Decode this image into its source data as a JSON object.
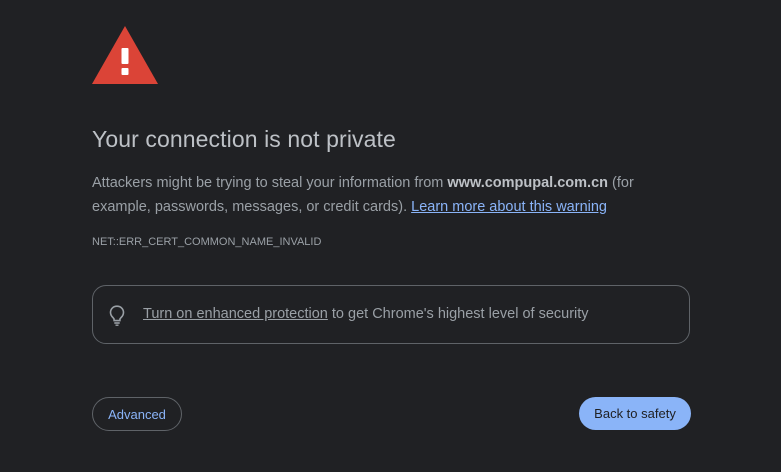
{
  "icons": {
    "warning": "warning-triangle-icon",
    "bulb": "lightbulb-icon"
  },
  "colors": {
    "background": "#202124",
    "warning_red": "#db4437",
    "link_blue": "#8ab4f8",
    "text_primary": "#bdc1c6",
    "text_secondary": "#9aa0a6"
  },
  "heading": "Your connection is not private",
  "description": {
    "prefix": "Attackers might be trying to steal your information from ",
    "domain": "www.compupal.com.cn",
    "suffix": " (for example, passwords, messages, or credit cards). ",
    "learn_more": "Learn more about this warning"
  },
  "error_code": "NET::ERR_CERT_COMMON_NAME_INVALID",
  "protection": {
    "link": "Turn on enhanced protection",
    "text": " to get Chrome's highest level of security"
  },
  "buttons": {
    "advanced": "Advanced",
    "back_to_safety": "Back to safety"
  }
}
